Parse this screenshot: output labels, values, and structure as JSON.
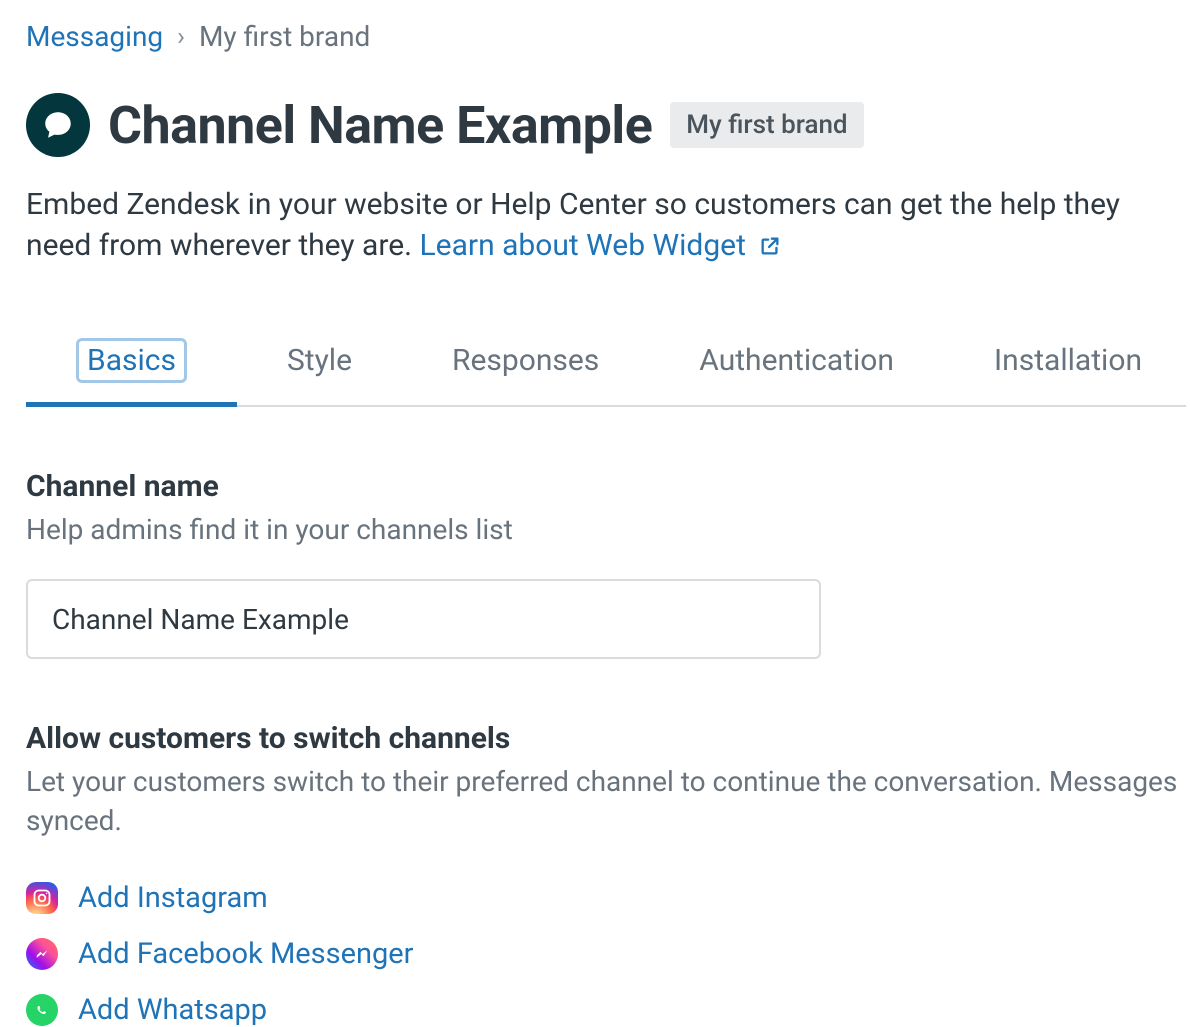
{
  "breadcrumb": {
    "root": "Messaging",
    "current": "My first brand"
  },
  "header": {
    "title": "Channel Name Example",
    "brand_badge": "My first brand",
    "description_pre": "Embed Zendesk in your website or Help Center so customers can get the help they need from wherever they are. ",
    "learn_link": "Learn about Web Widget"
  },
  "tabs": [
    {
      "id": "basics",
      "label": "Basics",
      "active": true
    },
    {
      "id": "style",
      "label": "Style",
      "active": false
    },
    {
      "id": "responses",
      "label": "Responses",
      "active": false
    },
    {
      "id": "authentication",
      "label": "Authentication",
      "active": false
    },
    {
      "id": "installation",
      "label": "Installation",
      "active": false
    }
  ],
  "channel_name": {
    "title": "Channel name",
    "help": "Help admins find it in your channels list",
    "value": "Channel Name Example"
  },
  "switch_channels": {
    "title": "Allow customers to switch channels",
    "help": "Let your customers switch to their preferred channel to continue the conversation. Messages synced.",
    "links": [
      {
        "id": "instagram",
        "label": "Add Instagram"
      },
      {
        "id": "facebook-messenger",
        "label": "Add Facebook Messenger"
      },
      {
        "id": "whatsapp",
        "label": "Add Whatsapp"
      }
    ]
  },
  "colors": {
    "link": "#1f73b7",
    "text": "#2f3941",
    "muted": "#68737d",
    "border": "#d8dcde"
  }
}
